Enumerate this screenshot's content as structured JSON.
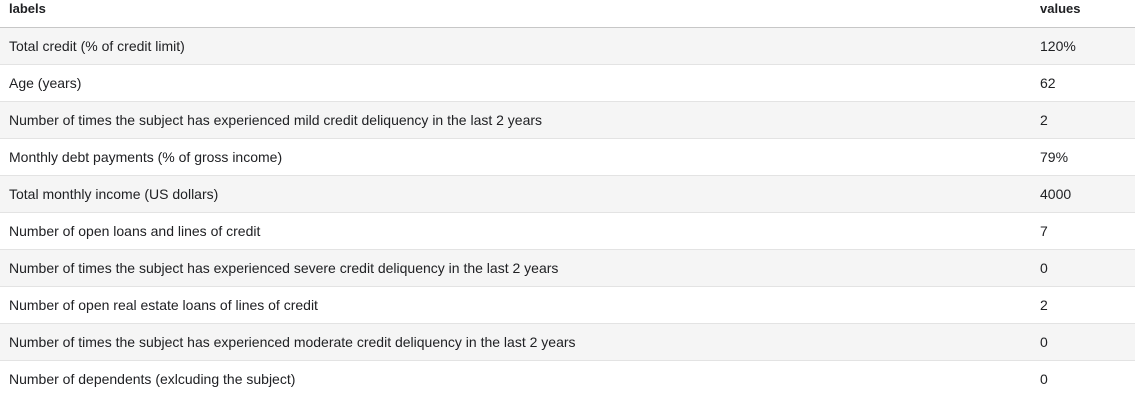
{
  "table": {
    "headers": [
      "labels",
      "values"
    ],
    "rows": [
      {
        "label": "Total credit (% of credit limit)",
        "value": "120%"
      },
      {
        "label": "Age (years)",
        "value": "62"
      },
      {
        "label": "Number of times the subject has experienced mild credit deliquency in the last 2 years",
        "value": "2"
      },
      {
        "label": "Monthly debt payments (% of gross income)",
        "value": "79%"
      },
      {
        "label": "Total monthly income (US dollars)",
        "value": "4000"
      },
      {
        "label": "Number of open loans and lines of credit",
        "value": "7"
      },
      {
        "label": "Number of times the subject has experienced severe credit deliquency in the last 2 years",
        "value": "0"
      },
      {
        "label": "Number of open real estate loans of lines of credit",
        "value": "2"
      },
      {
        "label": "Number of times the subject has experienced moderate credit deliquency in the last 2 years",
        "value": "0"
      },
      {
        "label": "Number of dependents (exlcuding the subject)",
        "value": "0"
      }
    ]
  }
}
